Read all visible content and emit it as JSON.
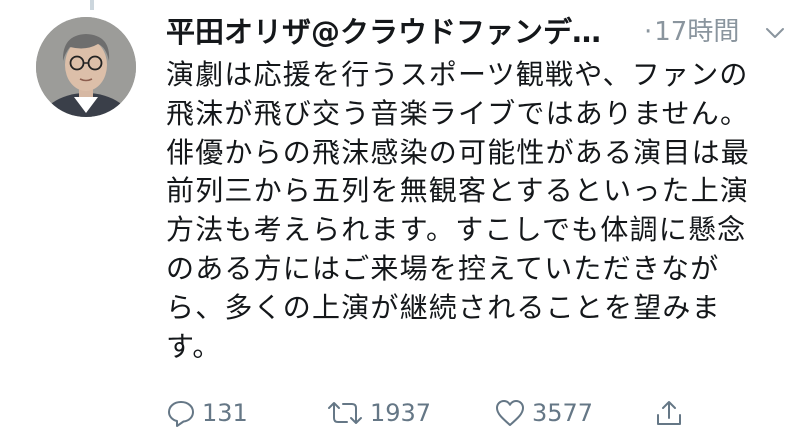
{
  "tweet": {
    "display_name": "平田オリザ@クラウドファンデ…",
    "time_dot": "·",
    "timestamp": "17時間",
    "body_lines": [
      "演劇は応援を行うスポーツ観戦や、ファンの",
      "飛沫が飛び交う音楽ライブではありません。",
      "俳優からの飛沫感染の可能性がある演目は最",
      "前列三から五列を無観客とするといった上演",
      "方法も考えられます。すこしでも体調に懸念",
      "のある方にはご来場を控えていただきなが",
      "ら、多くの上演が継続されることを望みま",
      "す。"
    ]
  },
  "actions": {
    "reply": {
      "icon": "reply-icon",
      "count": "131"
    },
    "retweet": {
      "icon": "retweet-icon",
      "count": "1937"
    },
    "like": {
      "icon": "heart-icon",
      "count": "3577"
    },
    "share": {
      "icon": "share-icon"
    }
  },
  "colors": {
    "text": "#14171a",
    "muted": "#657786",
    "meta": "#8a959e",
    "thread_line": "#ccd6dd"
  }
}
